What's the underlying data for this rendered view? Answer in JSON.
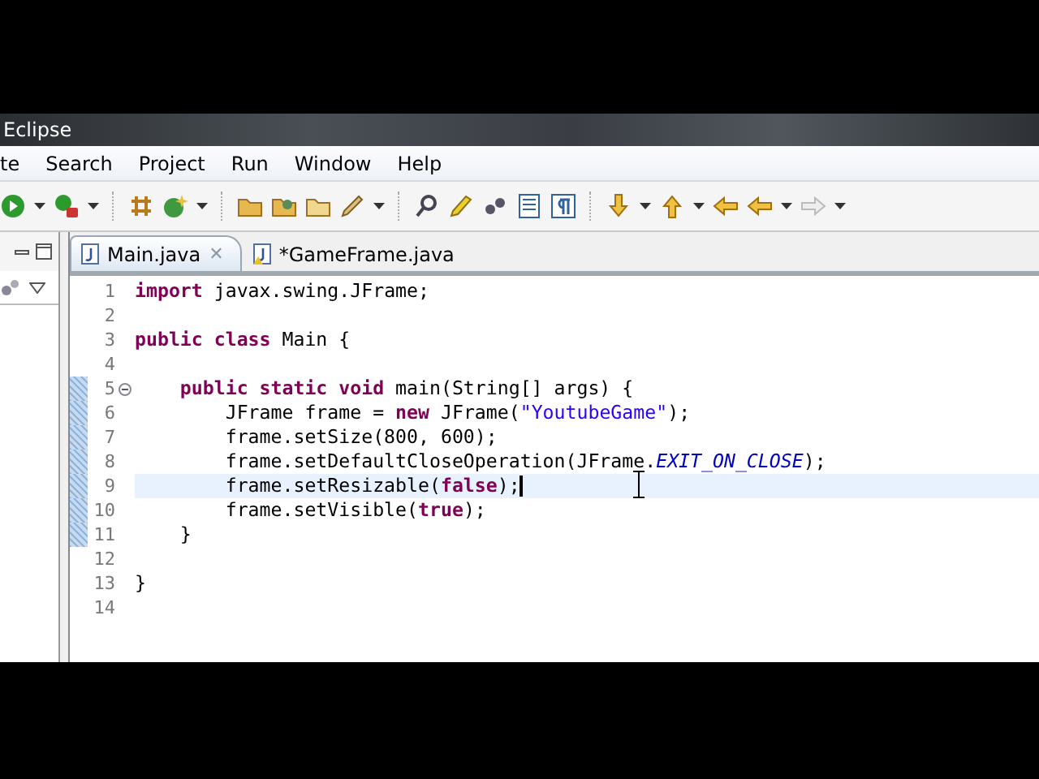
{
  "window": {
    "title": "Eclipse"
  },
  "menu": [
    "te",
    "Search",
    "Project",
    "Run",
    "Window",
    "Help"
  ],
  "tabs": [
    {
      "label": "Main.java",
      "selected": true,
      "close": "✕"
    },
    {
      "label": "*GameFrame.java",
      "selected": false
    }
  ],
  "editor": {
    "lines": [
      {
        "number": "1",
        "current": false,
        "changed": false,
        "fold": false,
        "tokens": [
          {
            "kind": "keyword",
            "text": "import"
          },
          {
            "kind": "plain",
            "text": " javax.swing.JFrame;"
          }
        ]
      },
      {
        "number": "2",
        "current": false,
        "changed": false,
        "fold": false
      },
      {
        "number": "3",
        "current": false,
        "changed": false,
        "fold": false,
        "tokens": [
          {
            "kind": "keyword",
            "text": "public class"
          },
          {
            "kind": "plain",
            "text": " Main {"
          }
        ]
      },
      {
        "number": "4",
        "current": false,
        "changed": false,
        "fold": false
      },
      {
        "number": "5",
        "current": false,
        "changed": true,
        "fold": true,
        "tokens": [
          {
            "kind": "keyword",
            "text": "    public static void"
          },
          {
            "kind": "plain",
            "text": " main(String[] args) {"
          }
        ]
      },
      {
        "number": "6",
        "current": false,
        "changed": true,
        "fold": false,
        "tokens": [
          {
            "kind": "plain",
            "text": "        JFrame frame = "
          },
          {
            "kind": "keyword",
            "text": "new"
          },
          {
            "kind": "plain",
            "text": " JFrame("
          },
          {
            "kind": "string",
            "text": "\"YoutubeGame\""
          },
          {
            "kind": "plain",
            "text": ");"
          }
        ]
      },
      {
        "number": "7",
        "current": false,
        "changed": true,
        "fold": false,
        "tokens": [
          {
            "kind": "plain",
            "text": "        frame.setSize(800, 600);"
          }
        ]
      },
      {
        "number": "8",
        "current": false,
        "changed": true,
        "fold": false,
        "tokens": [
          {
            "kind": "plain",
            "text": "        frame.setDefaultCloseOperation(JFrame."
          },
          {
            "kind": "constant",
            "text": "EXIT_ON_CLOSE"
          },
          {
            "kind": "plain",
            "text": ");"
          }
        ]
      },
      {
        "number": "9",
        "current": true,
        "changed": true,
        "fold": false,
        "tokens": [
          {
            "kind": "plain",
            "text": "        frame.setResizable("
          },
          {
            "kind": "keyword",
            "text": "false"
          },
          {
            "kind": "plain",
            "text": ");"
          }
        ]
      },
      {
        "number": "10",
        "current": false,
        "changed": true,
        "fold": false,
        "tokens": [
          {
            "kind": "plain",
            "text": "        frame.setVisible("
          },
          {
            "kind": "keyword",
            "text": "true"
          },
          {
            "kind": "plain",
            "text": ");"
          }
        ]
      },
      {
        "number": "11",
        "current": false,
        "changed": true,
        "fold": false,
        "tokens": [
          {
            "kind": "plain",
            "text": "    }"
          }
        ]
      },
      {
        "number": "12",
        "current": false,
        "changed": false,
        "fold": false
      },
      {
        "number": "13",
        "current": false,
        "changed": false,
        "fold": false,
        "tokens": [
          {
            "kind": "plain",
            "text": "}"
          }
        ]
      },
      {
        "number": "14",
        "current": false,
        "changed": false,
        "fold": false
      }
    ]
  }
}
